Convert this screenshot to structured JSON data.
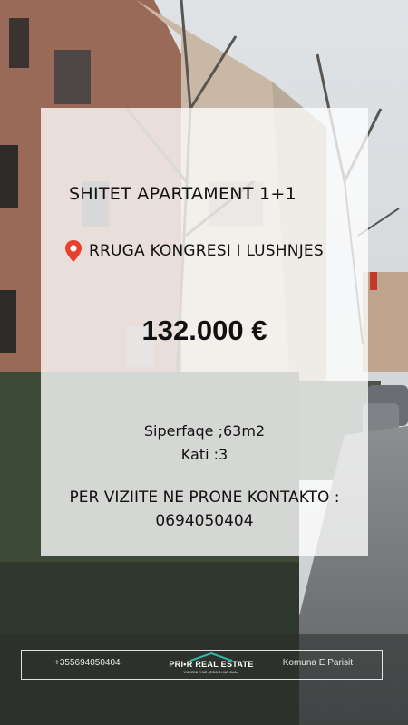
{
  "listing": {
    "title": "SHITET APARTAMENT 1+1",
    "location": "RRUGA KONGRESI I LUSHNJES",
    "price": "132.000 €",
    "area": "Siperfaqe ;63m2",
    "floor": "Kati :3",
    "contact_label": "PER VIZIITE NE PRONE KONTAKTO :",
    "contact_phone": "0694050404"
  },
  "footer": {
    "phone": "+355694050404",
    "brand": "PRI•R REAL ESTATE",
    "tagline": "VIZIONI YNE, ZGJIDHJA JUAJ",
    "area_name": "Komuna E Parisit"
  },
  "icons": {
    "location": "map-pin-icon",
    "logo_roof": "house-roof-icon"
  },
  "colors": {
    "pin": "#e8402f",
    "logo_roof": "#2fb8a8"
  }
}
